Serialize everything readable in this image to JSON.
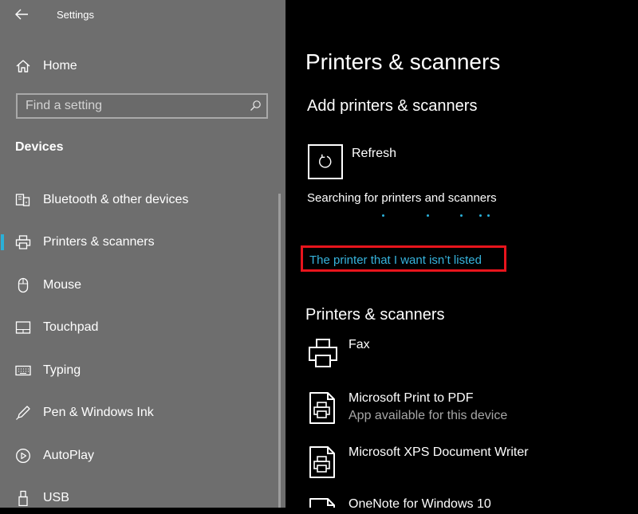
{
  "window": {
    "title": "Settings"
  },
  "sidebar": {
    "home_label": "Home",
    "search_placeholder": "Find a setting",
    "section_title": "Devices",
    "items": [
      {
        "label": "Bluetooth & other devices",
        "icon": "bluetooth-devices-icon"
      },
      {
        "label": "Printers & scanners",
        "icon": "printer-icon",
        "selected": true
      },
      {
        "label": "Mouse",
        "icon": "mouse-icon"
      },
      {
        "label": "Touchpad",
        "icon": "touchpad-icon"
      },
      {
        "label": "Typing",
        "icon": "keyboard-icon"
      },
      {
        "label": "Pen & Windows Ink",
        "icon": "pen-icon"
      },
      {
        "label": "AutoPlay",
        "icon": "autoplay-icon"
      },
      {
        "label": "USB",
        "icon": "usb-icon"
      }
    ]
  },
  "main": {
    "page_title": "Printers & scanners",
    "add_section_title": "Add printers & scanners",
    "refresh_label": "Refresh",
    "searching_text": "Searching for printers and scanners",
    "not_listed_link": "The printer that I want isn’t listed",
    "list_section_title": "Printers & scanners",
    "devices": [
      {
        "name": "Fax",
        "subtitle": "",
        "icon": "fax-printer-icon"
      },
      {
        "name": "Microsoft Print to PDF",
        "subtitle": "App available for this device",
        "icon": "document-printer-icon"
      },
      {
        "name": "Microsoft XPS Document Writer",
        "subtitle": "",
        "icon": "document-printer-icon"
      },
      {
        "name": "OneNote for Windows 10",
        "subtitle": "",
        "icon": "document-printer-icon"
      }
    ]
  },
  "colors": {
    "sidebar_bg": "#6e6e6e",
    "main_bg": "#000000",
    "accent": "#2ab0d8",
    "link": "#36b3dc",
    "highlight_box": "#e8141c"
  }
}
